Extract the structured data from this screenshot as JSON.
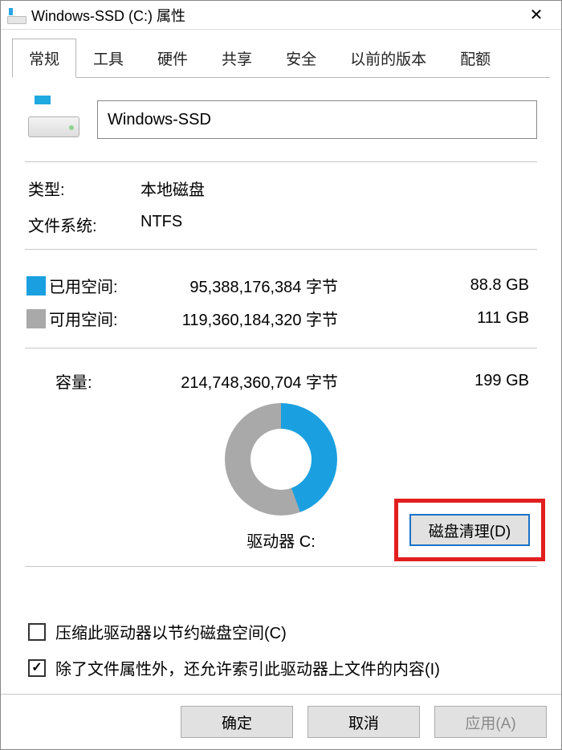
{
  "window": {
    "title": "Windows-SSD (C:) 属性"
  },
  "tabs": {
    "items": [
      "常规",
      "工具",
      "硬件",
      "共享",
      "安全",
      "以前的版本",
      "配额"
    ],
    "active_index": 0
  },
  "drive": {
    "name_value": "Windows-SSD",
    "type_label": "类型:",
    "type_value": "本地磁盘",
    "fs_label": "文件系统:",
    "fs_value": "NTFS"
  },
  "space": {
    "used_label": "已用空间:",
    "used_bytes": "95,388,176,384 字节",
    "used_gb": "88.8 GB",
    "free_label": "可用空间:",
    "free_bytes": "119,360,184,320 字节",
    "free_gb": "111 GB",
    "capacity_label": "容量:",
    "capacity_bytes": "214,748,360,704 字节",
    "capacity_gb": "199 GB"
  },
  "chart_data": {
    "type": "pie",
    "title": "",
    "series": [
      {
        "name": "已用空间",
        "value": 95388176384,
        "color": "#1aa0e0"
      },
      {
        "name": "可用空间",
        "value": 119360184320,
        "color": "#a9a9a9"
      }
    ]
  },
  "drive_letter_label": "驱动器 C:",
  "cleanup_button": "磁盘清理(D)",
  "options": {
    "compress_label": "压缩此驱动器以节约磁盘空间(C)",
    "compress_checked": false,
    "index_label": "除了文件属性外，还允许索引此驱动器上文件的内容(I)",
    "index_checked": true
  },
  "footer": {
    "ok": "确定",
    "cancel": "取消",
    "apply": "应用(A)"
  },
  "colors": {
    "used": "#1aa0e0",
    "free": "#a9a9a9",
    "highlight": "#e21f1f"
  }
}
